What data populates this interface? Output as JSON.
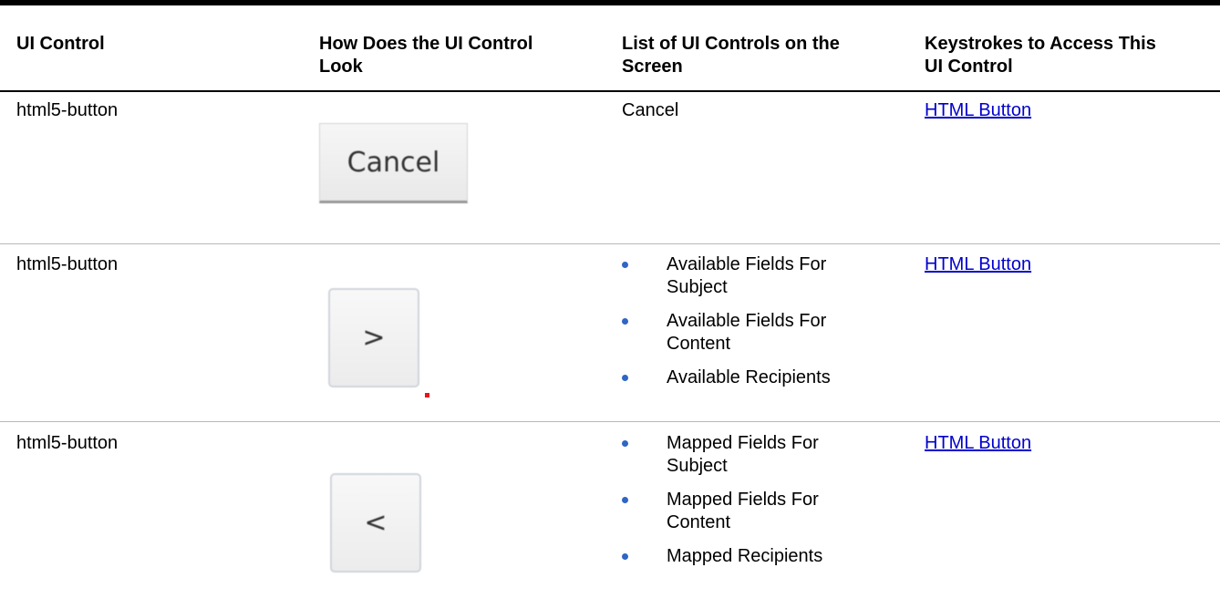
{
  "table": {
    "headers": [
      {
        "line1": "UI Control",
        "line2": ""
      },
      {
        "line1": "How Does the UI Control",
        "line2": "Look"
      },
      {
        "line1": "List of UI Controls on the",
        "line2": "Screen"
      },
      {
        "line1": "Keystrokes to Access This",
        "line2": "UI Control"
      }
    ],
    "rows": [
      {
        "ui_control": "html5-button",
        "preview_label": "Cancel",
        "screen_control": "Cancel",
        "keystroke_link": "HTML Button"
      },
      {
        "ui_control": "html5-button",
        "preview_label": ">",
        "screen_controls": [
          {
            "line1": "Available Fields For",
            "line2": "Subject"
          },
          {
            "line1": "Available Fields For",
            "line2": "Content"
          },
          {
            "line1": "Available Recipients",
            "line2": ""
          }
        ],
        "keystroke_link": "HTML Button"
      },
      {
        "ui_control": "html5-button",
        "preview_label": "<",
        "screen_controls": [
          {
            "line1": "Mapped Fields For",
            "line2": "Subject"
          },
          {
            "line1": "Mapped Fields For",
            "line2": "Content"
          },
          {
            "line1": "Mapped Recipients",
            "line2": ""
          }
        ],
        "keystroke_link": "HTML Button"
      }
    ]
  },
  "colors": {
    "link": "#0000cc",
    "bullet": "#2f66c4",
    "rule": "#b8b8b8",
    "marker": "#e8141b"
  }
}
